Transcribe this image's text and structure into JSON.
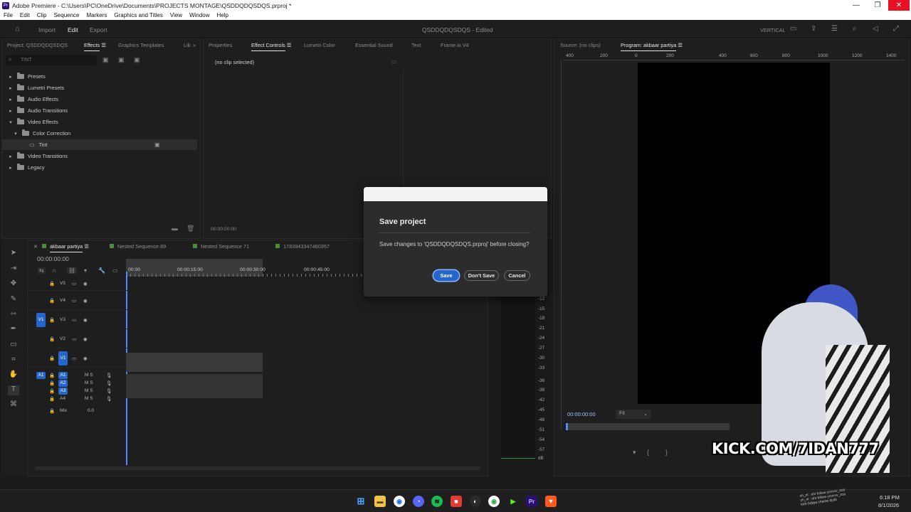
{
  "window": {
    "title": "Adobe Premiere - C:\\Users\\PC\\OneDrive\\Documents\\PROJECTS MONTAGE\\QSDDQDQSDQS.prproj *",
    "min": "—",
    "max": "❐",
    "close": "✕"
  },
  "menu": [
    "File",
    "Edit",
    "Clip",
    "Sequence",
    "Markers",
    "Graphics and Titles",
    "View",
    "Window",
    "Help"
  ],
  "workspace": {
    "import": "Import",
    "edit": "Edit",
    "export": "Export",
    "project_title": "QSDDQDQSDQS - Edited",
    "layout": "VERTICAL"
  },
  "effects_panel": {
    "tabs": [
      "Project: QSDDQDQSDQS",
      "Effects",
      "Graphics Templates",
      "Lib"
    ],
    "search_value": "TINT",
    "tree": [
      {
        "label": "Presets",
        "depth": 0,
        "caret": "▸"
      },
      {
        "label": "Lumetri Presets",
        "depth": 0,
        "caret": "▸"
      },
      {
        "label": "Audio Effects",
        "depth": 0,
        "caret": "▸"
      },
      {
        "label": "Audio Transitions",
        "depth": 0,
        "caret": "▸"
      },
      {
        "label": "Video Effects",
        "depth": 0,
        "caret": "▾"
      },
      {
        "label": "Color Correction",
        "depth": 1,
        "caret": "▾"
      },
      {
        "label": "Tint",
        "depth": 2,
        "caret": ""
      },
      {
        "label": "Video Transitions",
        "depth": 0,
        "caret": "▸"
      },
      {
        "label": "Legacy",
        "depth": 0,
        "caret": "▸"
      }
    ]
  },
  "effect_controls": {
    "tabs": [
      "Properties",
      "Effect Controls",
      "Lumetri Color",
      "Essential Sound",
      "Text",
      "Frame.io V4"
    ],
    "no_clip": "(no clip selected)",
    "timecode": "00:00:00:00"
  },
  "program_monitor": {
    "tabs": [
      "Source: (no clips)",
      "Program: akbaar partiya"
    ],
    "ruler": [
      "400",
      "200",
      "0",
      "200",
      "400",
      "600",
      "800",
      "1000",
      "1200",
      "1400"
    ],
    "timecode": "00:00:00:00",
    "fit": "Fit"
  },
  "timeline": {
    "tabs": [
      "akbaar partiya",
      "Nested Sequence 89",
      "Nested Sequence 71",
      "1783943347460357"
    ],
    "timecode": "00:00:00:00",
    "ruler": [
      "00:00",
      "00:00:15:00",
      "00:00:30:00",
      "00:00:45:00"
    ],
    "video_tracks": [
      "V5",
      "V4",
      "V3",
      "V2",
      "V1"
    ],
    "audio_tracks": [
      "A1",
      "A2",
      "A3",
      "A4"
    ],
    "mix_label": "Mix",
    "mix_value": "0.0",
    "src_v": "V1",
    "src_a": "A1"
  },
  "vu_meter": {
    "ticks": [
      "-12",
      "-15",
      "-18",
      "-21",
      "-24",
      "-27",
      "-30",
      "-33",
      "-36",
      "-39",
      "-42",
      "-45",
      "-48",
      "-51",
      "-54",
      "-57",
      "dB"
    ]
  },
  "dialog": {
    "title": "Save project",
    "message": "Save changes to 'QSDDQDQSDQS.prproj' before closing?",
    "save": "Save",
    "dont_save": "Don't Save",
    "cancel": "Cancel"
  },
  "overlay": {
    "watermark": "KICK.COM/7IDAN777",
    "chat": [
      "zh_nl : ohi follow yovvvv_nss",
      "zh_nl : ohi follow yovvvv_nss",
      "kick bdiiya chaine dyali"
    ]
  },
  "taskbar": {
    "time": "6:18 PM",
    "date": "8/1/2026"
  },
  "colors": {
    "accent": "#2466c9",
    "dialog_bg": "#2c2c2c",
    "kick_green": "#53fc18"
  }
}
